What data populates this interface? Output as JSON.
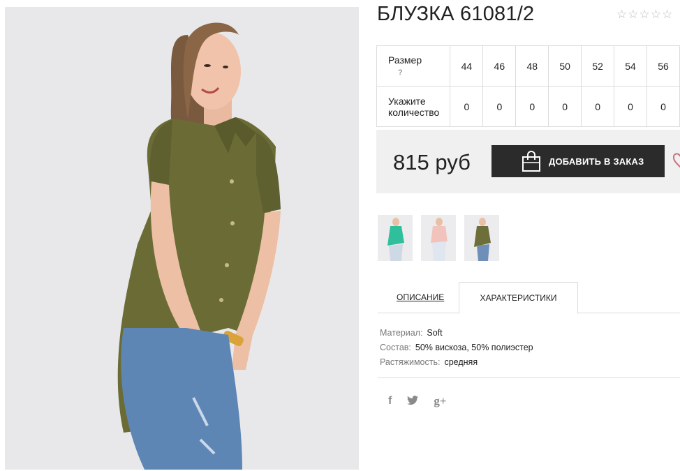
{
  "product": {
    "title": "БЛУЗКА 61081/2",
    "rating_stars": 5,
    "rating_filled": 0
  },
  "sizes": {
    "label": "Размер",
    "hint": "?",
    "values": [
      "44",
      "46",
      "48",
      "50",
      "52",
      "54",
      "56"
    ],
    "qty_label_line1": "Укажите",
    "qty_label_line2": "количество",
    "quantities": [
      "0",
      "0",
      "0",
      "0",
      "0",
      "0",
      "0"
    ]
  },
  "order": {
    "price": "815 руб",
    "add_button": "ДОБАВИТЬ В ЗАКАЗ"
  },
  "thumbnails": [
    {
      "name": "mint",
      "shirt_color": "#2fbf9a"
    },
    {
      "name": "pink",
      "shirt_color": "#f2c3bd"
    },
    {
      "name": "olive",
      "shirt_color": "#6d6e3a"
    }
  ],
  "tabs": {
    "description": "ОПИСАНИЕ",
    "characteristics": "ХАРАКТЕРИСТИКИ"
  },
  "specs": [
    {
      "key": "Материал:",
      "value": "Soft"
    },
    {
      "key": "Состав:",
      "value": "50% вискоза, 50% полиэстер"
    },
    {
      "key": "Растяжимость:",
      "value": "средняя"
    }
  ],
  "social": {
    "facebook": "f",
    "twitter": "🐦",
    "google_plus": "g+"
  },
  "colors": {
    "dark_button": "#2b2b2b",
    "panel_bg": "#f0f0f0",
    "heart": "#c9707e"
  }
}
